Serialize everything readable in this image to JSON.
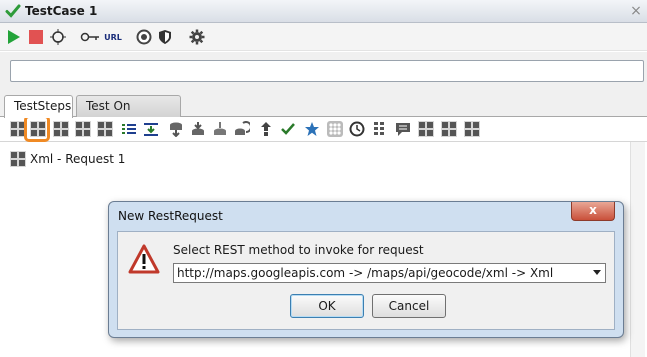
{
  "window": {
    "title": "TestCase 1",
    "close_glyph": "×"
  },
  "main_toolbar": {
    "items": [
      {
        "name": "run-icon"
      },
      {
        "name": "stop-icon"
      },
      {
        "name": "target-icon"
      },
      {
        "name": "key-icon"
      },
      {
        "name": "url-button",
        "label": "URL"
      },
      {
        "name": "coverage-icon"
      },
      {
        "name": "shield-icon"
      },
      {
        "name": "gear-icon"
      }
    ]
  },
  "endpoint": {
    "value": "",
    "placeholder": ""
  },
  "tabs": [
    {
      "label": "TestSteps",
      "active": true
    },
    {
      "label": "Test On Demand",
      "active": false
    }
  ],
  "steps_toolbar": {
    "highlighted": "rest-request-step-icon",
    "highlight_color": "#f08a24"
  },
  "steps": [
    {
      "label": "Xml - Request 1"
    }
  ],
  "dialog": {
    "title": "New RestRequest",
    "close_label": "x",
    "prompt": "Select REST method to invoke for request",
    "selected_method": "http://maps.googleapis.com -> /maps/api/geocode/xml -> Xml",
    "ok_label": "OK",
    "cancel_label": "Cancel"
  }
}
